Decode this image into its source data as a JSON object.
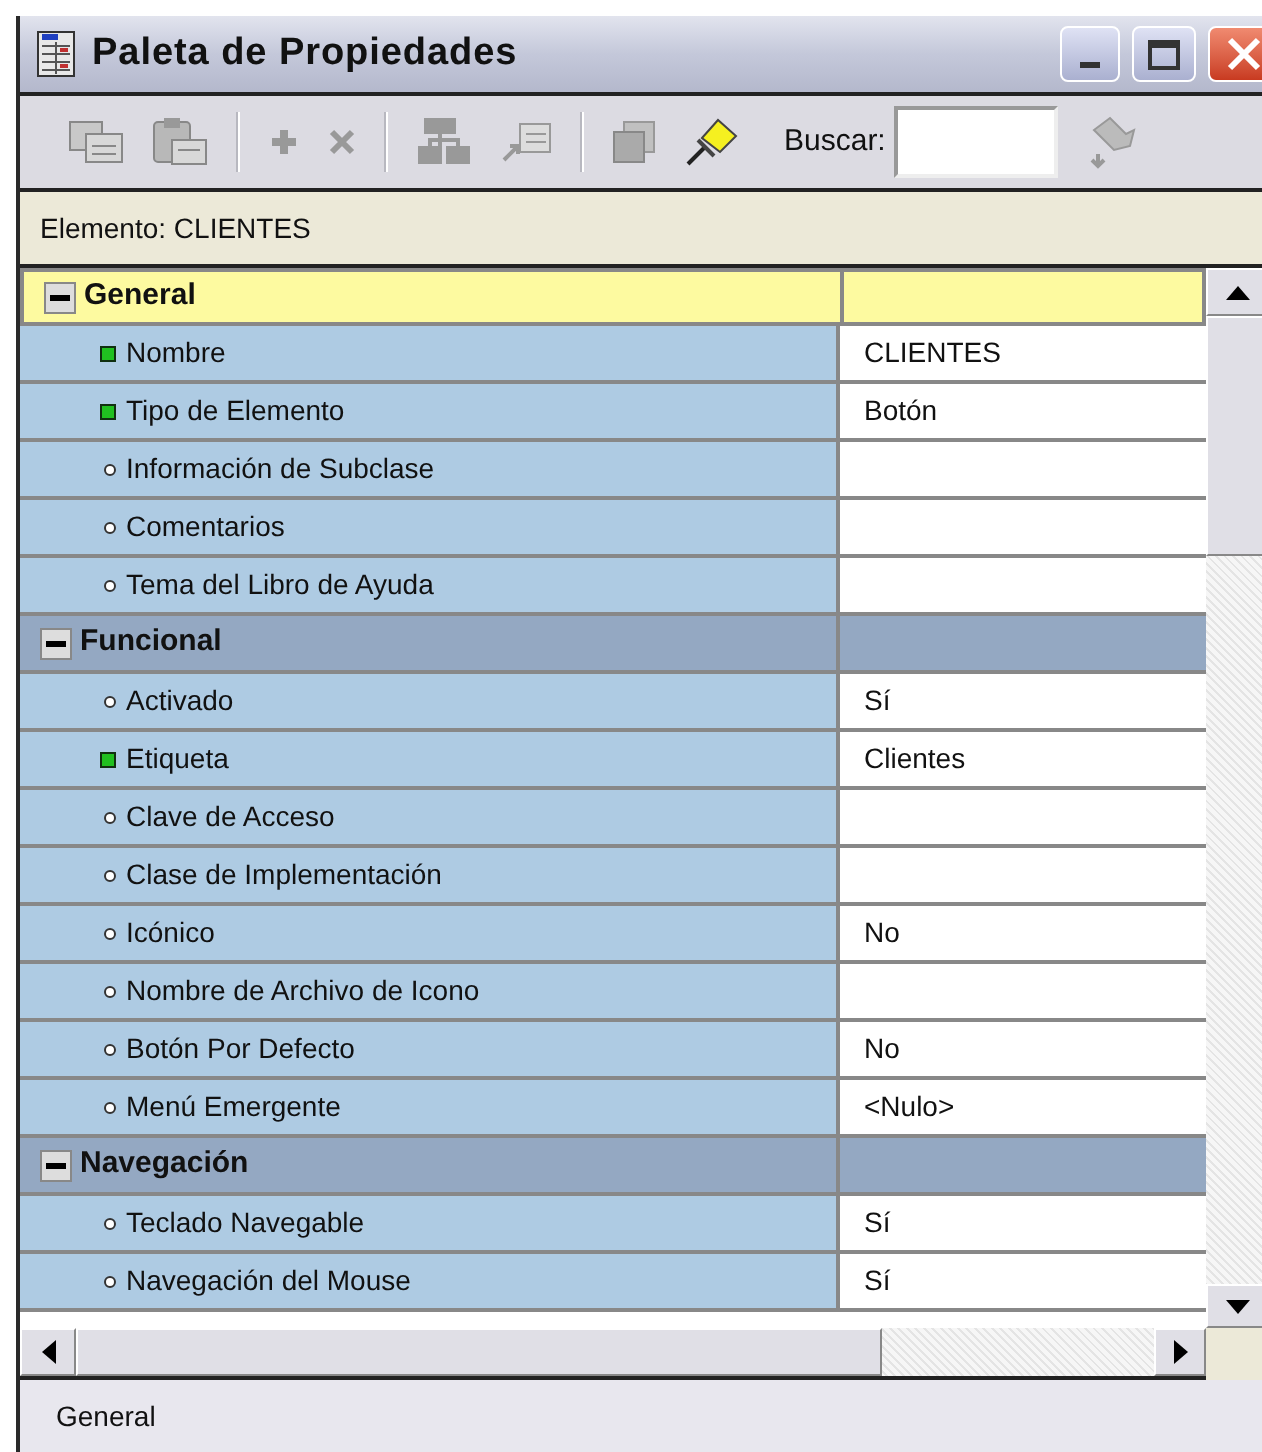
{
  "window": {
    "title": "Paleta de Propiedades"
  },
  "toolbar": {
    "search_label": "Buscar:"
  },
  "element_label": "Elemento: CLIENTES",
  "groups": [
    {
      "label": "General",
      "selected": true,
      "expanded": true,
      "properties": [
        {
          "name": "Nombre",
          "value": "CLIENTES",
          "kind": "key"
        },
        {
          "name": "Tipo de Elemento",
          "value": "Botón",
          "kind": "key"
        },
        {
          "name": "Información de Subclase",
          "kind": "plain"
        },
        {
          "name": "Comentarios",
          "kind": "plain"
        },
        {
          "name": "Tema del Libro de Ayuda",
          "kind": "plain"
        }
      ]
    },
    {
      "label": "Funcional",
      "selected": false,
      "expanded": true,
      "properties": [
        {
          "name": "Activado",
          "value": "Sí",
          "kind": "plain"
        },
        {
          "name": "Etiqueta",
          "value": "Clientes",
          "kind": "key"
        },
        {
          "name": "Clave de Acceso",
          "kind": "plain"
        },
        {
          "name": "Clase de Implementación",
          "kind": "plain"
        },
        {
          "name": "Icónico",
          "value": "No",
          "kind": "plain"
        },
        {
          "name": "Nombre de Archivo de Icono",
          "kind": "plain"
        },
        {
          "name": "Botón Por Defecto",
          "value": "No",
          "kind": "plain"
        },
        {
          "name": "Menú Emergente",
          "value": "<Nulo>",
          "kind": "plain"
        }
      ]
    },
    {
      "label": "Navegación",
      "selected": false,
      "expanded": true,
      "properties": [
        {
          "name": "Teclado Navegable",
          "value": "Sí",
          "kind": "plain"
        },
        {
          "name": "Navegación del Mouse",
          "value": "Sí",
          "kind": "plain"
        }
      ]
    }
  ],
  "status_bar": "General"
}
